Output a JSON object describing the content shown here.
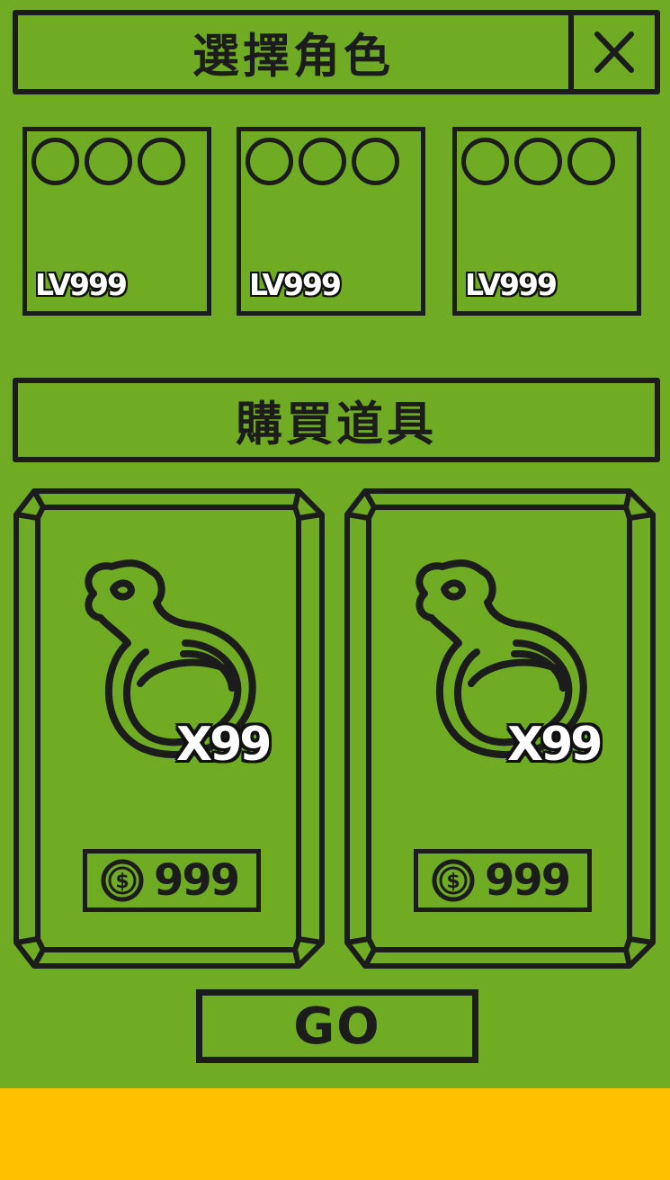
{
  "colors": {
    "background": "#6fac23",
    "outline": "#1c1c1c",
    "bottom_bar": "#ffc000",
    "label_text": "#ffffff"
  },
  "header": {
    "title": "選擇角色",
    "close_icon": "close-icon"
  },
  "characters": [
    {
      "level": "LV999",
      "slots": 3
    },
    {
      "level": "LV999",
      "slots": 3
    },
    {
      "level": "LV999",
      "slots": 3
    }
  ],
  "shop": {
    "title": "購買道具",
    "items": [
      {
        "icon": "potion-icon",
        "quantity": "X99",
        "price": "999",
        "currency_icon": "coin-icon"
      },
      {
        "icon": "potion-icon",
        "quantity": "X99",
        "price": "999",
        "currency_icon": "coin-icon"
      }
    ]
  },
  "go_button": {
    "label": "GO"
  }
}
